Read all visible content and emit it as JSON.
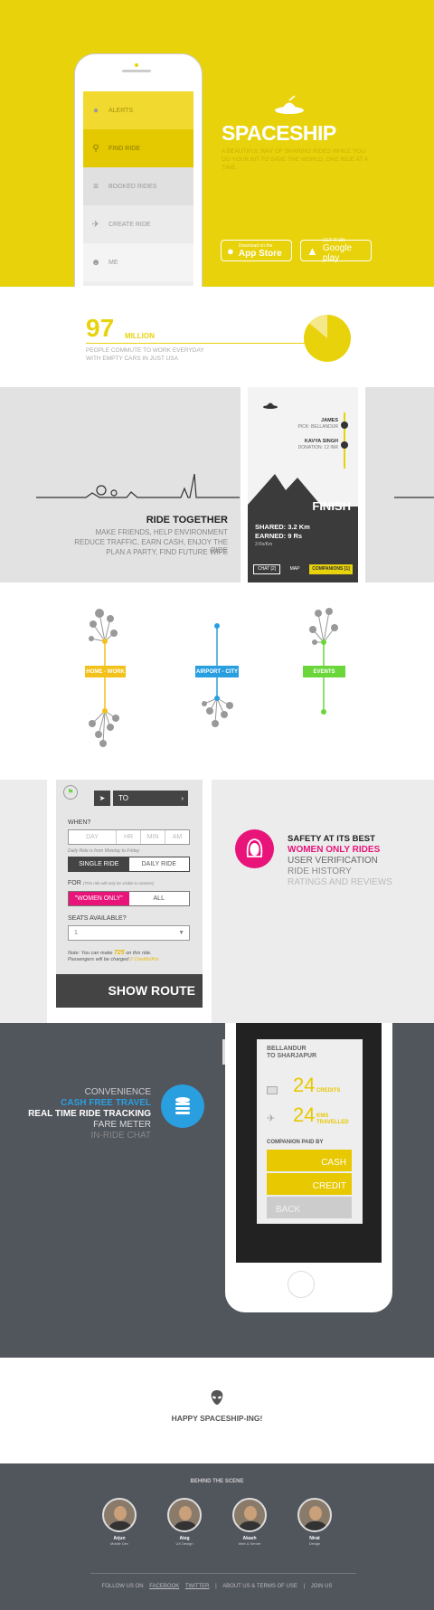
{
  "hero": {
    "menu": [
      {
        "label": "ALERTS",
        "icon": "chat-bubble-icon"
      },
      {
        "label": "FIND RIDE",
        "icon": "search-icon"
      },
      {
        "label": "BOOKED RIDES",
        "icon": "list-icon"
      },
      {
        "label": "CREATE RIDE",
        "icon": "car-icon"
      },
      {
        "label": "ME",
        "icon": "alien-icon"
      }
    ],
    "brand": "SPACESHIP",
    "tagline": "A BEAUTIFUL WAY OF SHARING RIDES WHILE YOU DO YOUR BIT TO SAVE THE WORLD, ONE RIDE AT A TIME.",
    "appstore": {
      "small": "Download on the",
      "large": "App Store"
    },
    "googleplay": {
      "small": "GET IT ON",
      "large": "Google play"
    }
  },
  "stats": {
    "number": "97",
    "unit": "MILLION",
    "line1": "PEOPLE COMMUTE TO WORK EVERYDAY",
    "line2": "WITH EMPTY CARS IN JUST USA",
    "pie_fraction": 0.14
  },
  "ride": {
    "title": "RIDE TOGETHER",
    "lines": [
      "MAKE FRIENDS, HELP ENVIRONMENT",
      "REDUCE TRAFFIC, EARN CASH, ENJOY THE RIDE",
      "PLAN A PARTY, FIND FUTURE WIFE"
    ],
    "stops": [
      {
        "name": "JAMES",
        "detail": "PICK: BELLANDUR"
      },
      {
        "name": "KAVYA SINGH",
        "detail": "DONATION: 12 INR"
      }
    ],
    "finish": "FINISH",
    "shared": "SHARED: 3.2 Km",
    "earned": "EARNED: 9 Rs",
    "rate": "3 Rs/Km",
    "tabs": [
      "CHAT [2]",
      "MAP",
      "COMPANIONS [1]"
    ]
  },
  "routes": {
    "tags": [
      {
        "label": "HOME - WORK",
        "color": "#f2c11a"
      },
      {
        "label": "AIRPORT - CITY",
        "color": "#2a9fe0"
      },
      {
        "label": "EVENTS",
        "color": "#6ad63a"
      }
    ]
  },
  "form": {
    "to_label": "TO",
    "when_label": "WHEN?",
    "when_fields": [
      "DAY",
      "HR",
      "MIN",
      "AM"
    ],
    "note_ride": "Daily Ride is from Monday to Friday",
    "single": "SINGLE RIDE",
    "daily": "DAILY RIDE",
    "for_label": "FOR",
    "for_note": "(This ride will only be visible to women)",
    "women": "\"WOMEN ONLY\"",
    "all": "ALL",
    "seats_label": "SEATS AVAILABLE?",
    "seats_value": "1",
    "note1": "Note: You can make",
    "note_amount": "725",
    "note2": "on this ride.",
    "note3": "Passengers will be charged",
    "note_rate": "2 Credits/Km",
    "show_route": "SHOW ROUTE"
  },
  "safety": {
    "title": "SAFETY AT ITS BEST",
    "highlight": "WOMEN ONLY RIDES",
    "lines": [
      "USER VERIFICATION",
      "RIDE HISTORY"
    ],
    "faded": "RATINGS AND REVIEWS",
    "accent": "#e8147a"
  },
  "conv": {
    "lines": [
      "CONVENIENCE",
      "CASH FREE TRAVEL",
      "REAL TIME RIDE TRACKING",
      "FARE METER",
      "IN-RIDE CHAT"
    ],
    "accent": "#2a9fe0",
    "route_from": "BELLANDUR",
    "route_to": "TO SHARJAPUR",
    "credits_num": "24",
    "credits_label": "CREDITS",
    "kms_num": "24",
    "kms_label1": "KMS",
    "kms_label2": "TRAVELLED",
    "paid_label": "COMPANION PAID BY",
    "cash": "CASH",
    "credit": "CREDIT",
    "back": "BACK"
  },
  "happy": {
    "text": "HAPPY SPACESHIP-ING!"
  },
  "team": {
    "heading": "BEHIND THE SCENE",
    "members": [
      {
        "name": "Arjun",
        "role": "Mobile Dev"
      },
      {
        "name": "Ateg",
        "role": "UX Design"
      },
      {
        "name": "Akash",
        "role": "Web & Server"
      },
      {
        "name": "Nirat",
        "role": "Design"
      }
    ],
    "footer": {
      "follow": "FOLLOW US ON",
      "facebook": "FACEBOOK",
      "twitter": "TWITTER",
      "about": "ABOUT US & TERMS OF USE",
      "join": "JOIN US"
    }
  }
}
